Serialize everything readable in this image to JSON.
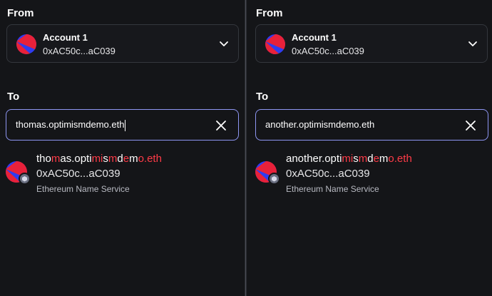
{
  "left": {
    "from_label": "From",
    "account_name": "Account 1",
    "account_address": "0xAC50c...aC039",
    "to_label": "To",
    "input_value": "thomas.optimismdemo.eth",
    "result": {
      "name_parts": [
        "tho",
        "m",
        "as.opti",
        "mi",
        "s",
        "m",
        "d",
        "e",
        "m",
        "o.eth"
      ],
      "address": "0xAC50c...aC039",
      "service": "Ethereum Name Service"
    }
  },
  "right": {
    "from_label": "From",
    "account_name": "Account 1",
    "account_address": "0xAC50c...aC039",
    "to_label": "To",
    "input_value": "another.optimismdemo.eth",
    "result": {
      "name_parts": [
        "another.opti",
        "mi",
        "s",
        "m",
        "d",
        "e",
        "m",
        "o.eth"
      ],
      "address": "0xAC50c...aC039",
      "service": "Ethereum Name Service"
    }
  },
  "colors": {
    "background": "#141518",
    "input_focus_border": "#8e96f2",
    "highlight": "#ff3b47",
    "avatar_red": "#e8213a",
    "avatar_blue": "#2f3cf0"
  },
  "icons": {
    "chevron": "chevron-down-icon",
    "clear": "close-icon",
    "badge": "ens-badge-icon"
  }
}
